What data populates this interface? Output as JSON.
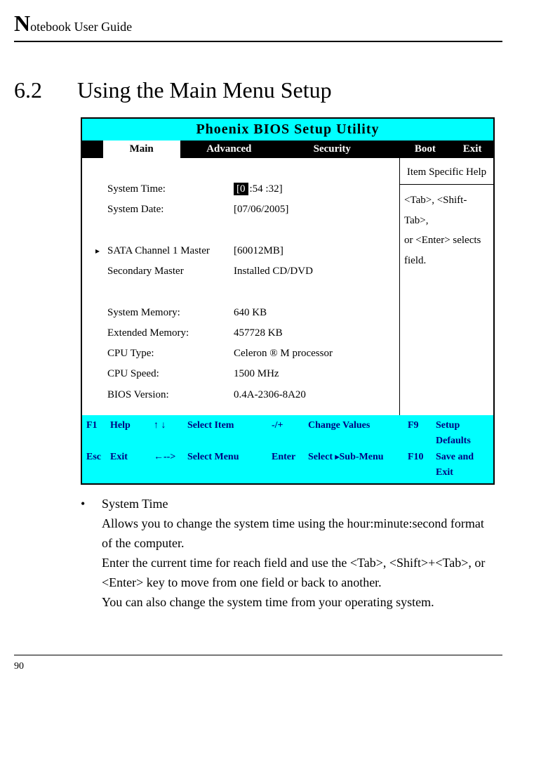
{
  "header": {
    "title_rest": "otebook User Guide"
  },
  "section": {
    "number": "6.2",
    "title": "Using the Main Menu Setup"
  },
  "bios": {
    "title": "Phoenix BIOS Setup Utility",
    "tabs": {
      "main": "Main",
      "advanced": "Advanced",
      "security": "Security",
      "boot": "Boot",
      "exit": "Exit"
    },
    "rows": {
      "time_label": "System Time:",
      "time_hh": "[0",
      "time_rest": ":54 :32]",
      "date_label": "System Date:",
      "date_value": "[07/06/2005]",
      "sata_label": "SATA Channel 1 Master",
      "sata_value": "[60012MB]",
      "sec_label": "Secondary  Master",
      "sec_value": "Installed CD/DVD",
      "sysmem_label": "System Memory:",
      "sysmem_value": "640 KB",
      "extmem_label": "Extended Memory:",
      "extmem_value": "457728 KB",
      "cputype_label": "CPU Type:",
      "cputype_value": "Celeron ® M processor",
      "cpuspeed_label": "CPU Speed:",
      "cpuspeed_value": "1500 MHz",
      "biosver_label": "BIOS Version:",
      "biosver_value": "0.4A-2306-8A20"
    },
    "help": {
      "title": "Item Specific Help",
      "body1": "<Tab>, <Shift-Tab>,",
      "body2": "or <Enter> selects",
      "body3": "field."
    },
    "footer": {
      "r1": {
        "k1": "F1",
        "k2": "Help",
        "k3": "↑ ↓",
        "k4": "Select Item",
        "k5": "-/+",
        "k6": "Change Values",
        "k7": "F9",
        "k8": "Setup Defaults"
      },
      "r2": {
        "k1": "Esc",
        "k2": "Exit",
        "k3": "←-->",
        "k4": "Select Menu",
        "k5": "Enter",
        "k6a": "Select ",
        "k6b": "Sub-Menu",
        "k7": "F10",
        "k8": "Save and Exit"
      }
    }
  },
  "body": {
    "bullet_title": "System Time",
    "p1": "Allows you to change the system time using the hour:minute:second format of the computer.",
    "p2": "Enter the current time for reach field and use the <Tab>, <Shift>+<Tab>, or <Enter> key to move from one field or back to another.",
    "p3": "You can also change the system time from your operating system."
  },
  "page_number": "90"
}
